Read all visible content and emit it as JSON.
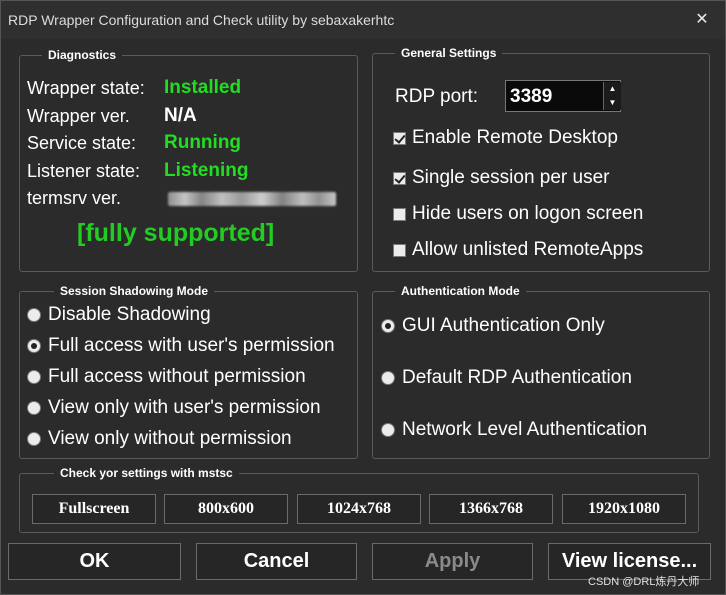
{
  "window": {
    "title": "RDP Wrapper Configuration and Check utility by sebaxakerhtc",
    "close_glyph": "✕"
  },
  "diagnostics": {
    "legend": "Diagnostics",
    "wrapper_state_label": "Wrapper state:",
    "wrapper_state_value": "Installed",
    "wrapper_ver_label": "Wrapper ver.",
    "wrapper_ver_value": "N/A",
    "service_state_label": "Service state:",
    "service_state_value": "Running",
    "listener_state_label": "Listener state:",
    "listener_state_value": "Listening",
    "termsrv_ver_label": "termsrv ver.",
    "support_status": "[fully supported]"
  },
  "general_settings": {
    "legend": "General Settings",
    "rdp_port_label": "RDP port:",
    "rdp_port_value": "3389",
    "checkboxes": [
      {
        "label": "Enable Remote Desktop",
        "checked": true
      },
      {
        "label": "Single session per user",
        "checked": true
      },
      {
        "label": "Hide users on logon screen",
        "checked": false
      },
      {
        "label": "Allow unlisted RemoteApps",
        "checked": false
      }
    ]
  },
  "shadowing": {
    "legend": "Session Shadowing Mode",
    "options": [
      {
        "label": "Disable Shadowing",
        "selected": false
      },
      {
        "label": "Full access with user's permission",
        "selected": true
      },
      {
        "label": "Full access without permission",
        "selected": false
      },
      {
        "label": "View only with user's permission",
        "selected": false
      },
      {
        "label": "View only without permission",
        "selected": false
      }
    ]
  },
  "authentication": {
    "legend": "Authentication Mode",
    "options": [
      {
        "label": "GUI Authentication Only",
        "selected": true
      },
      {
        "label": "Default RDP Authentication",
        "selected": false
      },
      {
        "label": "Network Level Authentication",
        "selected": false
      }
    ]
  },
  "mstsc": {
    "legend": "Check yor settings with mstsc",
    "buttons": [
      "Fullscreen",
      "800x600",
      "1024x768",
      "1366x768",
      "1920x1080"
    ]
  },
  "footer": {
    "ok": "OK",
    "cancel": "Cancel",
    "apply": "Apply",
    "view_license": "View license..."
  },
  "watermark": "CSDN @DRL炼丹大师",
  "colors": {
    "status_green": "#22dd22",
    "window_bg": "#333333"
  }
}
